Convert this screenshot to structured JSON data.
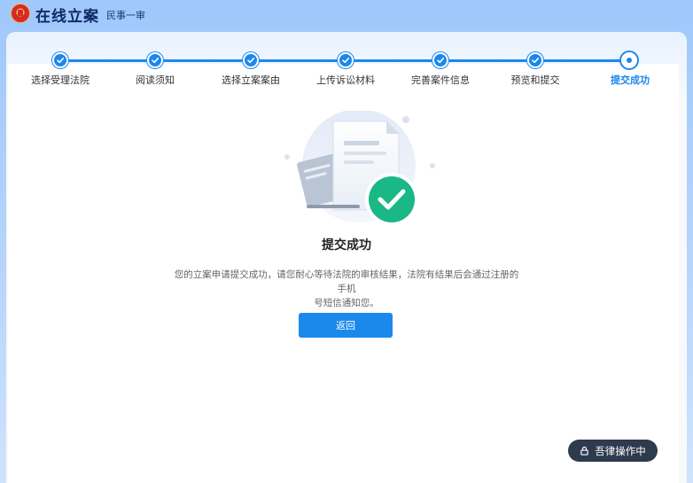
{
  "header": {
    "title": "在线立案",
    "subtitle": "民事一审"
  },
  "steps": [
    {
      "label": "选择受理法院",
      "status": "done"
    },
    {
      "label": "阅读须知",
      "status": "done"
    },
    {
      "label": "选择立案案由",
      "status": "done"
    },
    {
      "label": "上传诉讼材料",
      "status": "done"
    },
    {
      "label": "完善案件信息",
      "status": "done"
    },
    {
      "label": "预览和提交",
      "status": "done"
    },
    {
      "label": "提交成功",
      "status": "current"
    }
  ],
  "result": {
    "title": "提交成功",
    "description_line1": "您的立案申请提交成功，请您耐心等待法院的审核结果，法院有结果后会通过注册的手机",
    "description_line2": "号短信通知您。",
    "back_label": "返回"
  },
  "floating": {
    "label": "吾律操作中"
  },
  "colors": {
    "primary": "#1b88ec",
    "success": "#19b884",
    "header_bg": "#9fc8fb",
    "float_bg": "#2e3a4d"
  }
}
